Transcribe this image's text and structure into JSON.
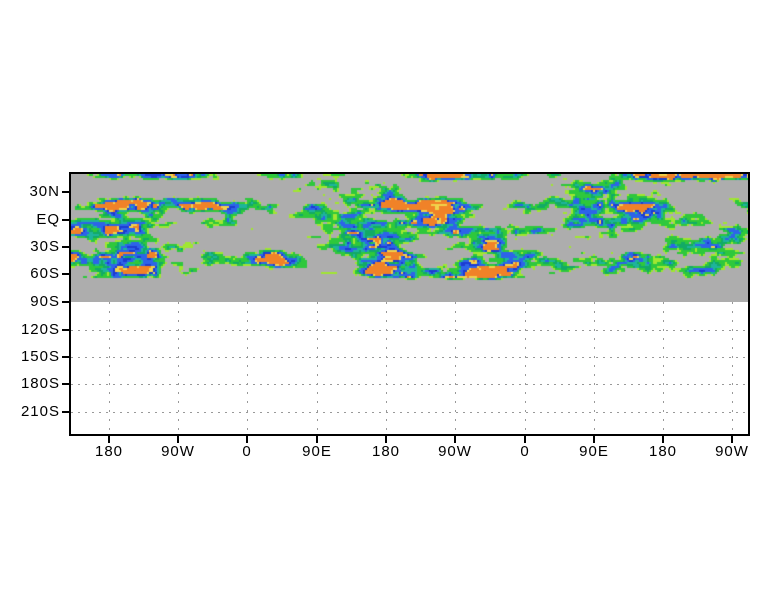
{
  "chart_data": {
    "type": "heatmap",
    "title": "",
    "x_axis": {
      "tick_labels": [
        "180",
        "90W",
        "0",
        "90E",
        "180",
        "90W",
        "0",
        "90E",
        "180",
        "90W"
      ]
    },
    "y_axis": {
      "tick_labels": [
        "30N",
        "EQ",
        "30S",
        "60S",
        "90S",
        "120S",
        "150S",
        "180S",
        "210S"
      ]
    },
    "legend": "none",
    "grid": {
      "visible": true,
      "color": "#999999",
      "style": "dotted"
    },
    "frame_color": "#000000",
    "field": {
      "description": "speckled shaded grid-cell field drawn over a gray no-data background; colored data occupies the band from the top of the frame down to just below the 60S line, solid gray continues to the 90S line, white with dotted gridlines below",
      "background_color": "#adadad",
      "palette": [
        {
          "name": "light-green",
          "hex": "#a0e632"
        },
        {
          "name": "green",
          "hex": "#2ec83c"
        },
        {
          "name": "sea-green",
          "hex": "#12aa66"
        },
        {
          "name": "turquoise",
          "hex": "#1eb49b"
        },
        {
          "name": "blue",
          "hex": "#2d64e8"
        },
        {
          "name": "deep-blue",
          "hex": "#1d3cd2"
        },
        {
          "name": "yellow",
          "hex": "#f0d24b"
        },
        {
          "name": "orange",
          "hex": "#f08228"
        }
      ]
    }
  }
}
